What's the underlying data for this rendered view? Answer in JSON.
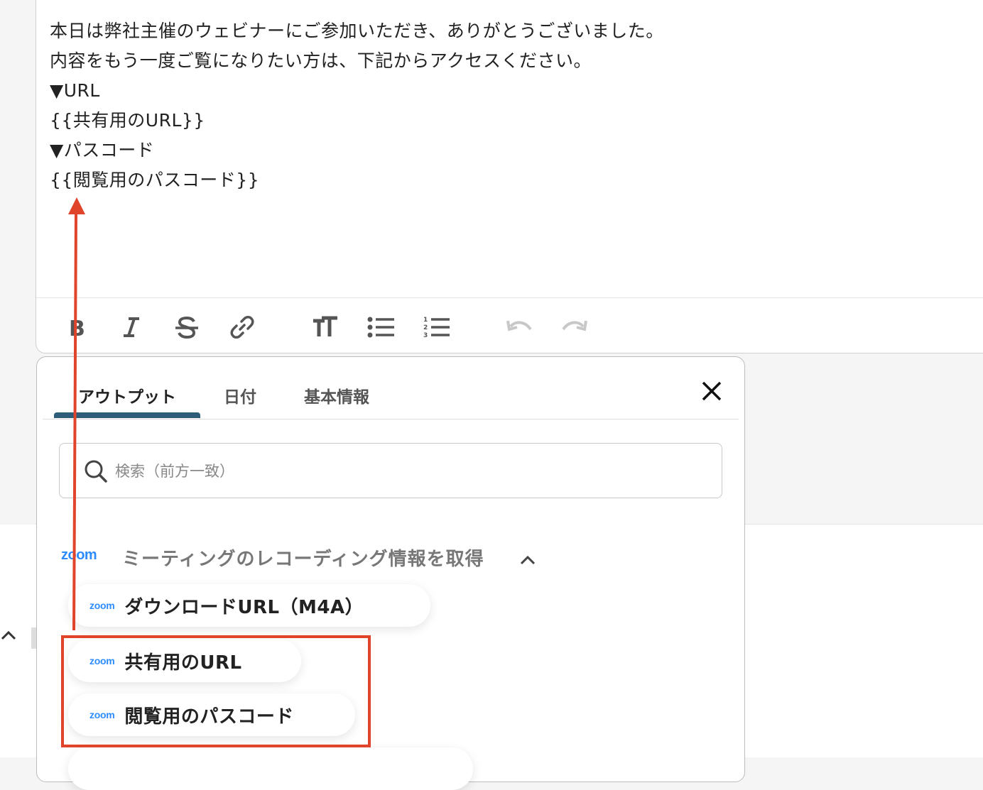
{
  "editor": {
    "lines": [
      "本日は弊社主催のウェビナーにご参加いただき、ありがとうございました。",
      "内容をもう一度ご覧になりたい方は、下記からアクセスください。",
      "▼URL",
      "{{共有用のURL}}",
      "▼パスコード",
      "{{閲覧用のパスコード}}"
    ],
    "toolbar": [
      "bold-icon",
      "italic-icon",
      "strikethrough-icon",
      "link-icon",
      "text-size-icon",
      "bullet-list-icon",
      "numbered-list-icon",
      "undo-icon",
      "redo-icon"
    ]
  },
  "panel": {
    "tabs": [
      {
        "label": "アウトプット",
        "active": true
      },
      {
        "label": "日付",
        "active": false
      },
      {
        "label": "基本情報",
        "active": false
      }
    ],
    "search_placeholder": "検索（前方一致）",
    "section": {
      "logo": "zoom",
      "title": "ミーティングのレコーディング情報を取得"
    },
    "items": [
      {
        "logo": "zoom",
        "label": "ダウンロードURL（M4A）"
      },
      {
        "logo": "zoom",
        "label": "共有用のURL"
      },
      {
        "logo": "zoom",
        "label": "閲覧用のパスコード"
      }
    ]
  },
  "colors": {
    "accent_tab": "#2d5d78",
    "annotation_red": "#e0442b",
    "zoom_blue": "#2d8cff"
  }
}
